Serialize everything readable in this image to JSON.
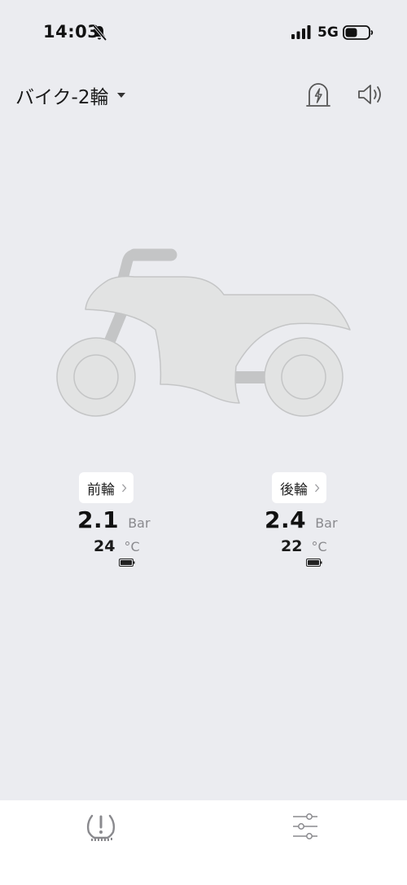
{
  "status_bar": {
    "time": "14:03",
    "network": "5G"
  },
  "header": {
    "vehicle_name": "バイク-2輪"
  },
  "tires": [
    {
      "position_label": "前輪",
      "pressure": "2.1",
      "pressure_unit": "Bar",
      "temperature": "24",
      "temperature_unit": "°C"
    },
    {
      "position_label": "後輪",
      "pressure": "2.4",
      "pressure_unit": "Bar",
      "temperature": "22",
      "temperature_unit": "°C"
    }
  ],
  "icons": {
    "bell": "bell-slash-icon",
    "signal": "cellular-signal-icon",
    "battery": "battery-icon",
    "caret": "caret-down-icon",
    "alarm": "alarm-light-icon",
    "sound": "speaker-icon",
    "tpms": "tire-pressure-warning-icon",
    "settings": "sliders-icon"
  },
  "colors": {
    "background": "#ebecf0",
    "bike_fill": "#e2e3e3",
    "bike_stroke": "#c4c5c6",
    "icon_gray": "#8a8a8e"
  }
}
